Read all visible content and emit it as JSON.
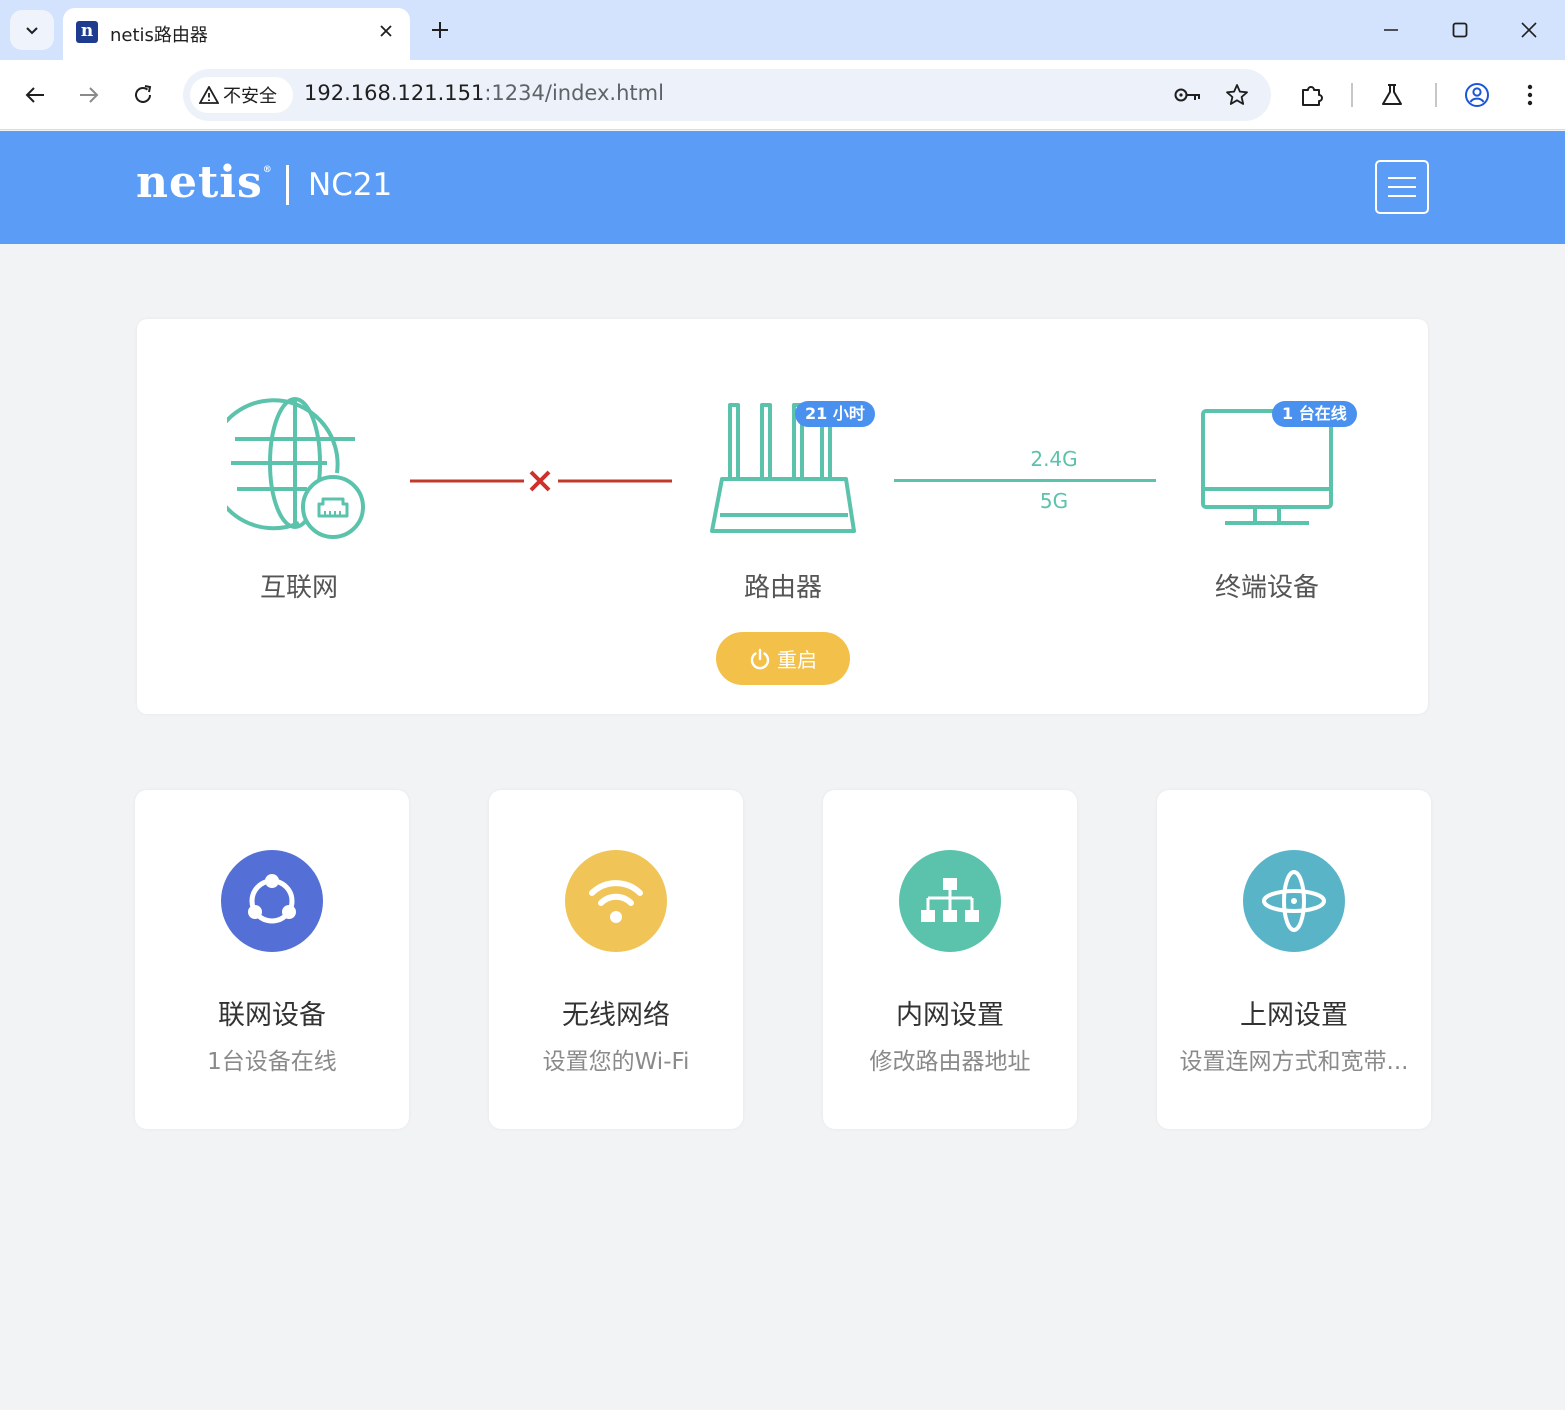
{
  "browser": {
    "tab_title": "netis路由器",
    "favicon_letter": "n",
    "security_label": "不安全",
    "url_host": "192.168.121.151",
    "url_rest": ":1234/index.html"
  },
  "header": {
    "logo": "netis",
    "logo_mark": "®",
    "model": "NC21"
  },
  "topology": {
    "internet_label": "互联网",
    "router_label": "路由器",
    "router_badge": "21 小时",
    "terminal_label": "终端设备",
    "terminal_badge": "1 台在线",
    "band_24": "2.4G",
    "band_5": "5G",
    "restart_label": "重启",
    "colors": {
      "teal": "#5bc2ac",
      "disconnected": "#c0392b",
      "badge": "#4a90ee",
      "restart": "#f3c14a"
    }
  },
  "tiles": [
    {
      "title": "联网设备",
      "subtitle": "1台设备在线",
      "icon": "share-network-icon",
      "color": "#5470d6"
    },
    {
      "title": "无线网络",
      "subtitle": "设置您的Wi-Fi",
      "icon": "wifi-icon",
      "color": "#f0c457"
    },
    {
      "title": "内网设置",
      "subtitle": "修改路由器地址",
      "icon": "sitemap-icon",
      "color": "#5bc2ac"
    },
    {
      "title": "上网设置",
      "subtitle": "设置连网方式和宽带...",
      "icon": "planet-icon",
      "color": "#5ab4c8"
    }
  ]
}
